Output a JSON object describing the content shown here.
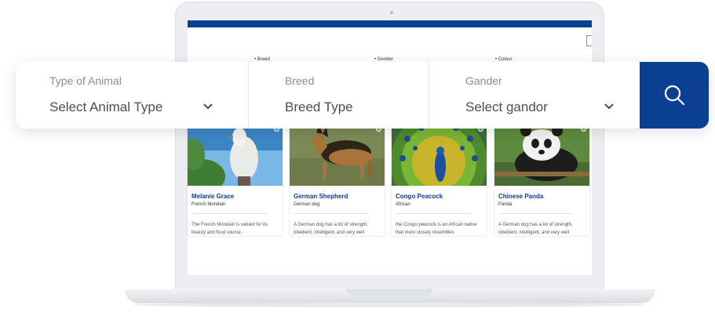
{
  "search": {
    "fields": [
      {
        "label": "Type of Animal",
        "value": "Select Animal Type"
      },
      {
        "label": "Breed",
        "value": "Breed Type"
      },
      {
        "label": "Gander",
        "value": "Select gandor"
      }
    ]
  },
  "screen": {
    "filters": [
      "• Breed",
      "• Gender",
      "• Colour"
    ],
    "cards": [
      {
        "title": "Melanie Grace",
        "subtitle": "French Mondain",
        "description": "The French Mondain is valued for its beauty and food source."
      },
      {
        "title": "German Shepherd",
        "subtitle": "German dog",
        "description": "A German dog has a lot of strength, obedient, intelligent, and very well"
      },
      {
        "title": "Congo Peacock",
        "subtitle": "African",
        "description": "the Congo peacock is an African native that more closely resembles"
      },
      {
        "title": "Chinese Panda",
        "subtitle": "Panda",
        "description": "A German dog has a lot of strength, obedient, intelligent, and very well"
      }
    ]
  },
  "colors": {
    "brand": "#0b3f91"
  }
}
